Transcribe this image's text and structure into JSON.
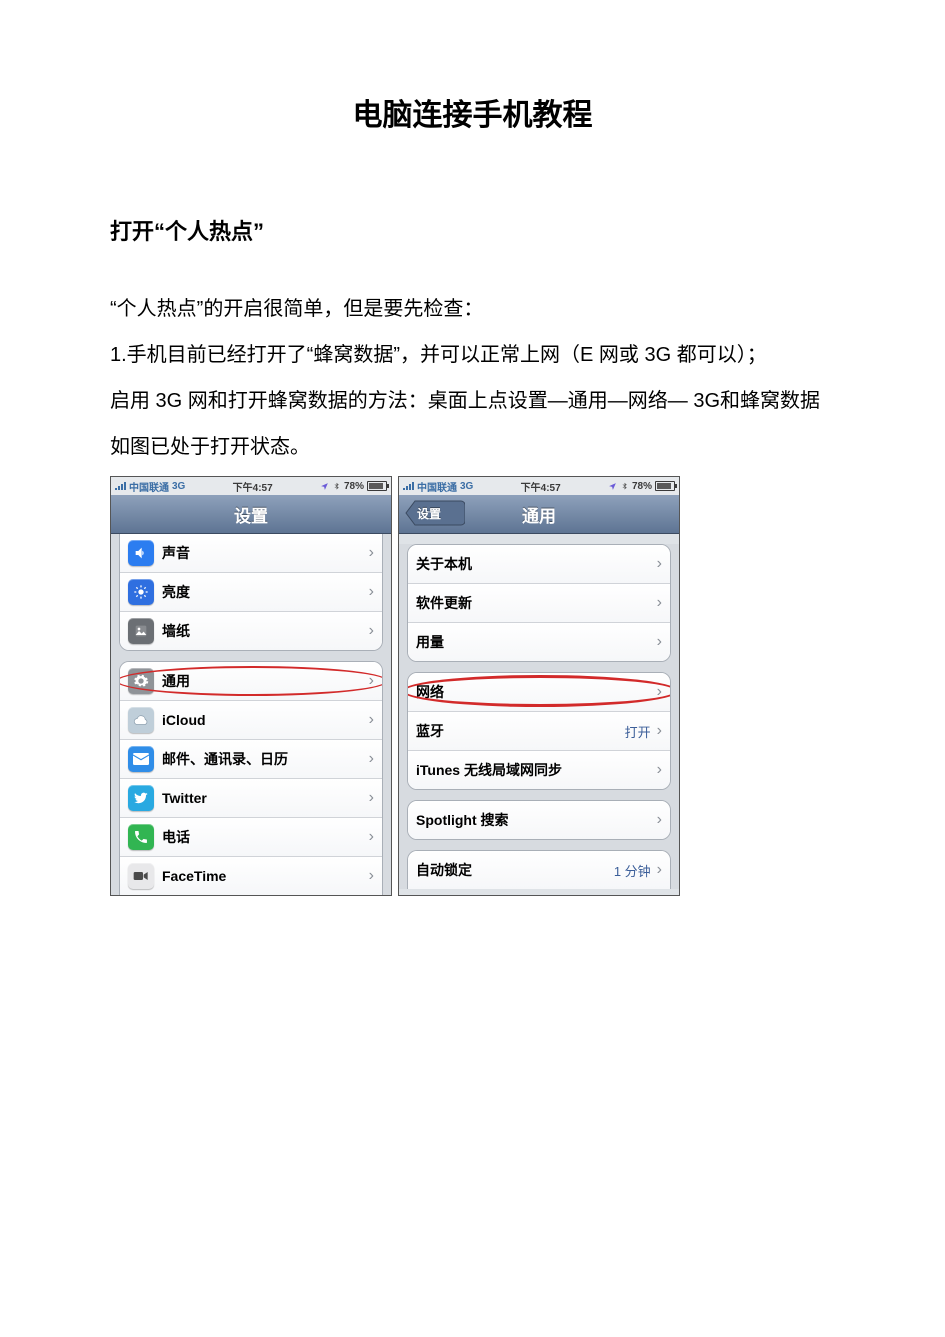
{
  "doc": {
    "title": "电脑连接手机教程",
    "section_heading": "打开“个人热点”",
    "p1": "“个人热点”的开启很简单，但是要先检查：",
    "p2": "1.手机目前已经打开了“蜂窝数据”，并可以正常上网（E 网或 3G 都可以）；",
    "p3": "启用 3G 网和打开蜂窝数据的方法：桌面上点设置—通用—网络— 3G和蜂窝数据",
    "p4": "如图已处于打开状态。"
  },
  "phone_left": {
    "status": {
      "carrier": "中国联通",
      "net": "3G",
      "time": "下午4:57",
      "battery": "78%"
    },
    "nav_title": "设置",
    "rows_top": [
      {
        "icon_bg": "#2c7df0",
        "icon_name": "speaker-icon",
        "label": "声音"
      },
      {
        "icon_bg": "#2f6fe0",
        "icon_name": "brightness-icon",
        "label": "亮度"
      },
      {
        "icon_bg": "#6b6f74",
        "icon_name": "wallpaper-icon",
        "label": "墙纸"
      }
    ],
    "rows_mid": [
      {
        "icon_bg": "#8f9398",
        "icon_name": "gear-icon",
        "label": "通用",
        "highlight": true
      },
      {
        "icon_bg": "#bfced9",
        "icon_name": "cloud-icon",
        "label": "iCloud"
      },
      {
        "icon_bg": "#2f8de8",
        "icon_name": "mail-icon",
        "label": "邮件、通讯录、日历"
      },
      {
        "icon_bg": "#29a9e1",
        "icon_name": "twitter-icon",
        "label": "Twitter"
      },
      {
        "icon_bg": "#31b552",
        "icon_name": "phone-icon",
        "label": "电话"
      },
      {
        "icon_bg": "#e8e8ea",
        "icon_name": "facetime-icon",
        "label": "FaceTime"
      }
    ]
  },
  "phone_right": {
    "status": {
      "carrier": "中国联通",
      "net": "3G",
      "time": "下午4:57",
      "battery": "78%"
    },
    "back_label": "设置",
    "nav_title": "通用",
    "rows_g1": [
      {
        "label": "关于本机"
      },
      {
        "label": "软件更新"
      },
      {
        "label": "用量"
      }
    ],
    "rows_g2": [
      {
        "label": "网络",
        "highlight": true
      },
      {
        "label": "蓝牙",
        "value": "打开"
      },
      {
        "label": "iTunes 无线局域网同步"
      }
    ],
    "rows_g3": [
      {
        "label": "Spotlight 搜索"
      }
    ],
    "rows_g4": [
      {
        "label": "自动锁定",
        "value": "1 分钟"
      }
    ]
  }
}
